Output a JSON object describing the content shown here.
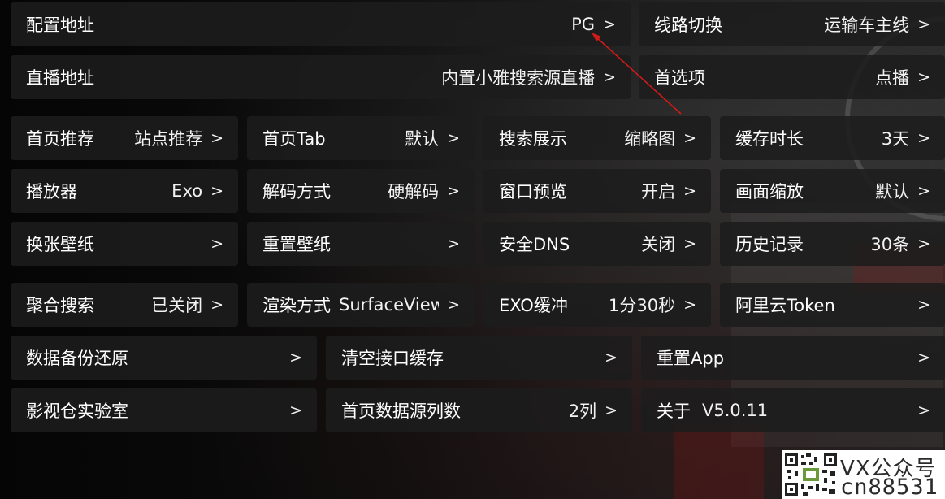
{
  "rows": [
    [
      {
        "label": "配置地址",
        "value": "PG"
      },
      {
        "label": "线路切换",
        "value": "运输车主线"
      }
    ],
    [
      {
        "label": "直播地址",
        "value": "内置小雅搜索源直播"
      },
      {
        "label": "首选项",
        "value": "点播"
      }
    ],
    [
      {
        "label": "首页推荐",
        "value": "站点推荐"
      },
      {
        "label": "首页Tab",
        "value": "默认"
      },
      {
        "label": "搜索展示",
        "value": "缩略图"
      },
      {
        "label": "缓存时长",
        "value": "3天"
      }
    ],
    [
      {
        "label": "播放器",
        "value": "Exo"
      },
      {
        "label": "解码方式",
        "value": "硬解码"
      },
      {
        "label": "窗口预览",
        "value": "开启"
      },
      {
        "label": "画面缩放",
        "value": "默认"
      }
    ],
    [
      {
        "label": "换张壁纸",
        "value": ""
      },
      {
        "label": "重置壁纸",
        "value": ""
      },
      {
        "label": "安全DNS",
        "value": "关闭"
      },
      {
        "label": "历史记录",
        "value": "30条"
      }
    ],
    [
      {
        "label": "聚合搜索",
        "value": "已关闭"
      },
      {
        "label": "渲染方式",
        "value": "SurfaceView"
      },
      {
        "label": "EXO缓冲",
        "value": "1分30秒"
      },
      {
        "label": "阿里云Token",
        "value": ""
      }
    ],
    [
      {
        "label": "数据备份还原",
        "value": ""
      },
      {
        "label": "清空接口缓存",
        "value": ""
      },
      {
        "label": "重置App",
        "value": ""
      }
    ],
    [
      {
        "label": "影视仓实验室",
        "value": ""
      },
      {
        "label": "首页数据源列数",
        "value": "2列"
      },
      {
        "label": "关于",
        "value": "V5.0.11"
      }
    ]
  ],
  "chevron": ">",
  "watermark": {
    "line1": "VX公众号",
    "line2": "cn88531"
  },
  "colors": {
    "button_bg": "#1c1c1c",
    "text": "#ffffff",
    "arrow": "#d11a1a"
  }
}
